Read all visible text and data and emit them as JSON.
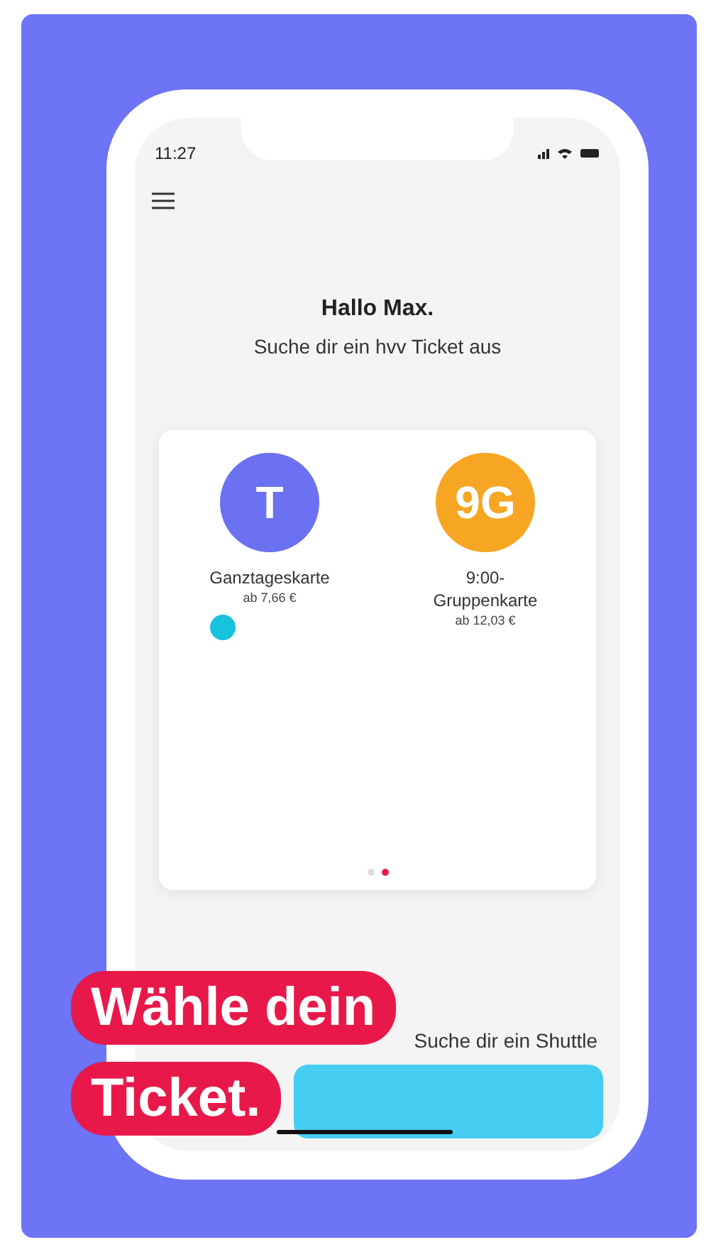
{
  "status_bar": {
    "time": "11:27"
  },
  "greeting": {
    "title": "Hallo Max.",
    "subtitle": "Suche dir ein hvv Ticket aus"
  },
  "tickets": [
    {
      "icon_text": "T",
      "color": "#6b71f0",
      "name": "Ganztageskarte",
      "price": "ab 7,66 €"
    },
    {
      "icon_text": "9G",
      "color": "#f6a623",
      "name": "9:00-Gruppenkarte",
      "price": "ab 12,03 €"
    }
  ],
  "card_marker": {
    "color": "#17c3dc"
  },
  "pager": [
    {
      "selected": false
    },
    {
      "selected": true
    }
  ],
  "shuttle": {
    "label": "Suche dir ein Shuttle"
  },
  "headline": [
    "Wähle dein",
    "Ticket."
  ]
}
